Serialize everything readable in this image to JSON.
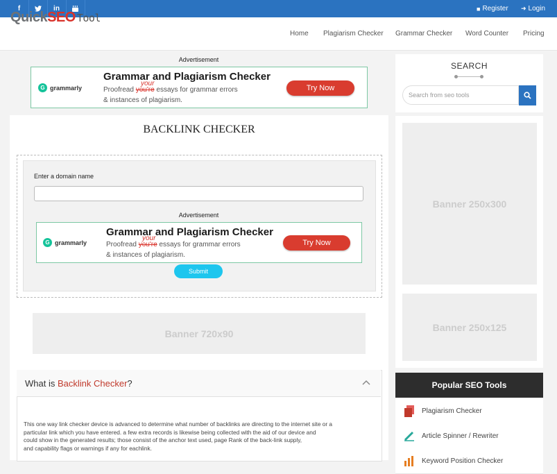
{
  "topbar": {
    "social": [
      {
        "name": "facebook-icon",
        "glyph": "f"
      },
      {
        "name": "twitter-icon",
        "glyph": "t"
      },
      {
        "name": "linkedin-icon",
        "glyph": "in"
      },
      {
        "name": "youtube-icon",
        "glyph": "▶"
      }
    ],
    "register_label": "Register",
    "login_label": "Login"
  },
  "header": {
    "logo": {
      "part1": "Quick",
      "part2": "SEO",
      "part3": "Tool"
    },
    "nav": [
      "Home",
      "Plagiarism Checker",
      "Grammar Checker",
      "Word Counter",
      "Pricing"
    ]
  },
  "ads": {
    "label": "Advertisement",
    "brand": "grammarly",
    "title": "Grammar and Plagiarism Checker",
    "desc_prefix": "Proofread",
    "desc_struck": "you're",
    "desc_correction": "your",
    "desc_suffix": "essays for grammar errors",
    "desc_line2": "& instances of plagiarism.",
    "cta": "Try Now"
  },
  "main": {
    "title": "BACKLINK CHECKER",
    "field_label": "Enter a domain name",
    "field_value": "",
    "submit_label": "Submit",
    "banner_728": "Banner  720x90",
    "what_prefix": "What is ",
    "what_highlight": "Backlink Checker",
    "what_suffix": "?",
    "description": [
      "This one way link checker device is advanced to determine what number of backlinks are directing to the internet site or a",
      "particular link which you have entered. a few extra records is likewise being collected with the aid of our device and",
      "could show in the generated results; those consist of the anchor text used, page Rank of the back-link supply,",
      "and capability flags or warnings if any for eachlink."
    ]
  },
  "sidebar": {
    "search_title": "SEARCH",
    "search_placeholder": "Search from seo tools",
    "banner_300": "Banner  250x300",
    "banner_125": "Banner  250x125",
    "popular_title": "Popular SEO Tools",
    "popular": [
      "Plagiarism Checker",
      "Article Spinner / Rewriter",
      "Keyword Position Checker"
    ]
  },
  "colors": {
    "brand_blue": "#2b73c0",
    "accent_red": "#d9332b",
    "submit_cyan": "#1ec6ee"
  }
}
